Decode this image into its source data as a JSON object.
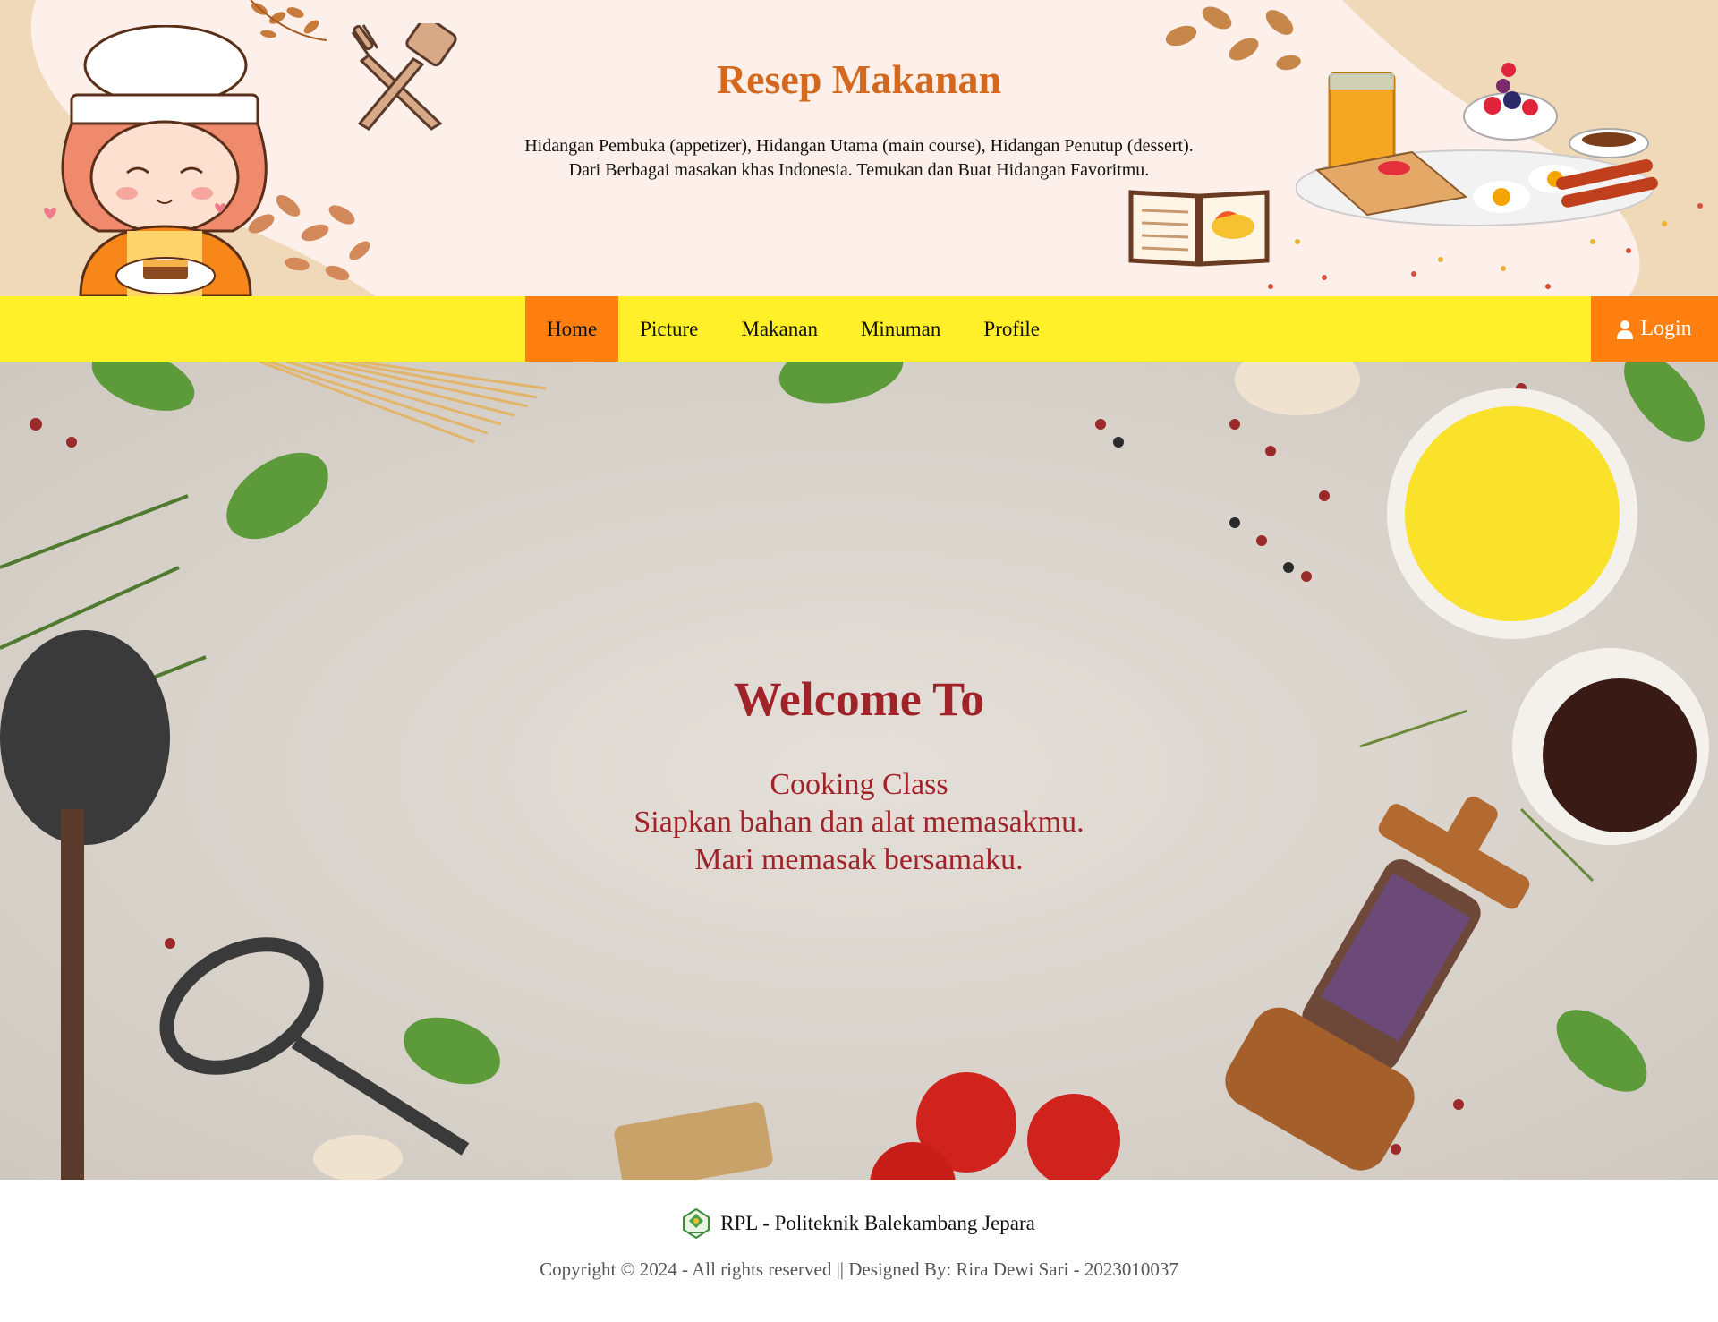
{
  "header": {
    "title": "Resep Makanan",
    "description_line1": "Hidangan Pembuka (appetizer), Hidangan Utama (main course), Hidangan Penutup (dessert).",
    "description_line2": "Dari Berbagai masakan khas Indonesia. Temukan dan Buat Hidangan Favoritmu."
  },
  "nav": {
    "items": [
      {
        "label": "Home",
        "active": true
      },
      {
        "label": "Picture"
      },
      {
        "label": "Makanan"
      },
      {
        "label": "Minuman"
      },
      {
        "label": "Profile"
      }
    ],
    "login_label": "Login",
    "login_icon": "user-icon"
  },
  "hero": {
    "title": "Welcome To",
    "line1": "Cooking Class",
    "line2": "Siapkan bahan dan alat memasakmu.",
    "line3": "Mari memasak bersamaku."
  },
  "footer": {
    "org_icon": "college-logo-icon",
    "org": "RPL - Politeknik Balekambang Jepara",
    "copyright": "Copyright © 2024 - All rights reserved || Designed By: Rira Dewi Sari - 2023010037"
  },
  "colors": {
    "header_bg": "#fdefe9",
    "title": "#d2691e",
    "nav_bg": "#fff02a",
    "nav_active": "#ff7f11",
    "hero_text": "#a0232a"
  }
}
